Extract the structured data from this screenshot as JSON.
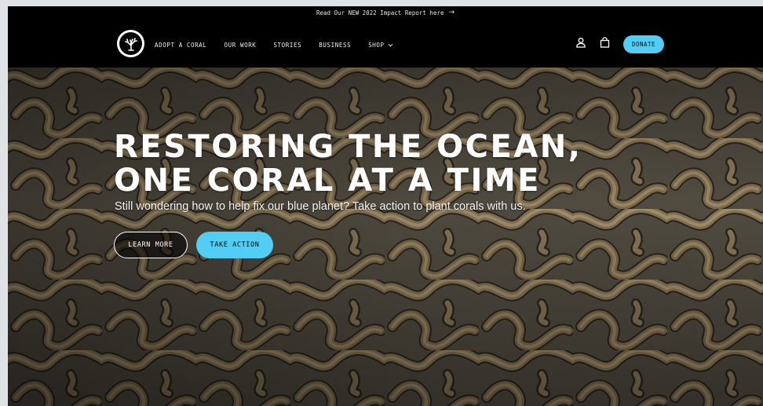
{
  "announcement": {
    "text": "Read Our NEW 2022 Impact Report here",
    "arrow_icon": "arrow-right-icon"
  },
  "nav": {
    "logo_icon": "coral-logo-icon",
    "items": [
      {
        "label": "ADOPT A CORAL"
      },
      {
        "label": "OUR WORK"
      },
      {
        "label": "STORIES"
      },
      {
        "label": "BUSINESS"
      },
      {
        "label": "SHOP",
        "icon": "chevron-down-icon"
      }
    ],
    "account_icon": "user-icon",
    "cart_icon": "shopping-bag-icon",
    "donate_label": "DONATE"
  },
  "hero": {
    "headline_line1": "RESTORING THE OCEAN,",
    "headline_line2": "ONE CORAL AT A TIME",
    "subheadline": "Still wondering how to help fix our blue planet? Take action to plant corals with us.",
    "learn_more_label": "LEARN MORE",
    "take_action_label": "TAKE ACTION"
  },
  "colors": {
    "accent": "#52cdf3",
    "nav_bg": "#000000",
    "text_light": "#ffffff"
  }
}
